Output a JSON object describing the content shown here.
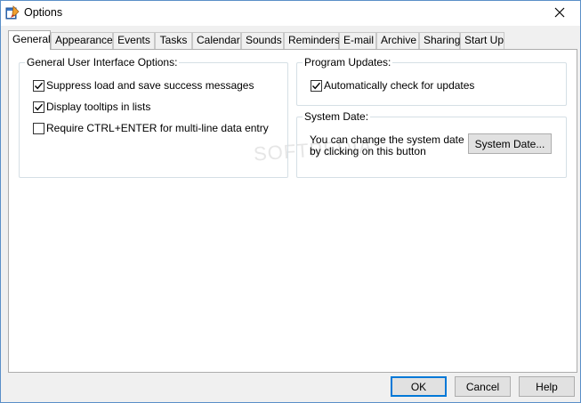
{
  "window": {
    "title": "Options",
    "close_glyph": "✕"
  },
  "tabs": [
    {
      "label": "General",
      "active": true
    },
    {
      "label": "Appearance"
    },
    {
      "label": "Events"
    },
    {
      "label": "Tasks"
    },
    {
      "label": "Calendar"
    },
    {
      "label": "Sounds"
    },
    {
      "label": "Reminders"
    },
    {
      "label": "E-mail"
    },
    {
      "label": "Archive"
    },
    {
      "label": "Sharing"
    },
    {
      "label": "Start Up"
    }
  ],
  "general_ui": {
    "title": "General User Interface Options:",
    "options": [
      {
        "label": "Suppress load and save success messages",
        "checked": true
      },
      {
        "label": "Display tooltips in lists",
        "checked": true
      },
      {
        "label": "Require CTRL+ENTER for multi-line data entry",
        "checked": false
      }
    ]
  },
  "program_updates": {
    "title": "Program Updates:",
    "option": {
      "label": "Automatically check for updates",
      "checked": true
    }
  },
  "system_date": {
    "title": "System Date:",
    "description_line1": "You can change the system date",
    "description_line2": "by clicking on this button",
    "button_label": "System Date..."
  },
  "footer": {
    "ok_label": "OK",
    "cancel_label": "Cancel",
    "help_label": "Help"
  },
  "watermark": "SOFTPEDIA"
}
